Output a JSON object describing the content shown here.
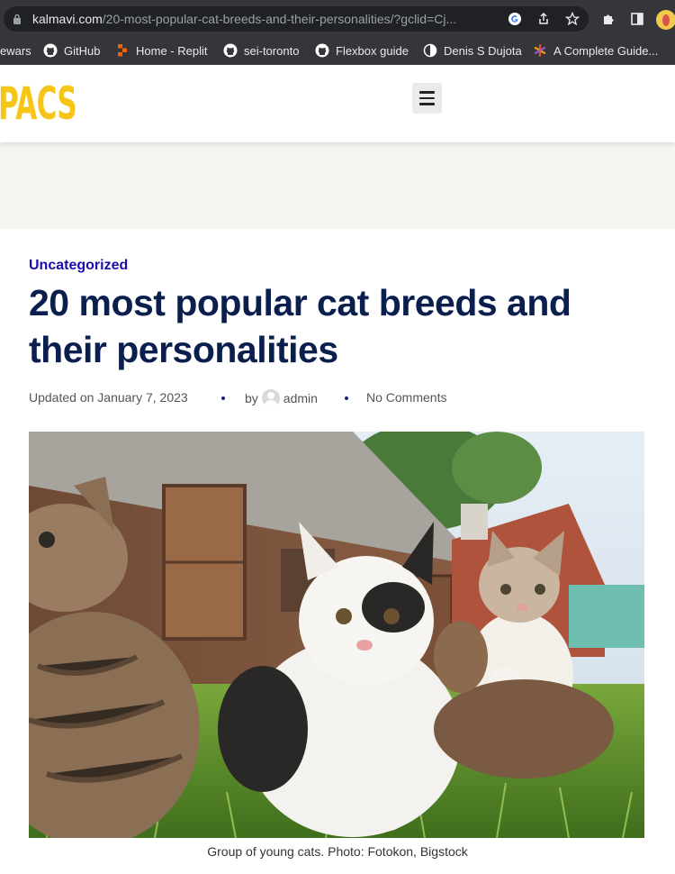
{
  "browser": {
    "url_host": "kalmavi.com",
    "url_path": "/20-most-popular-cat-breeds-and-their-personalities/?gclid=Cj...",
    "bookmarks": [
      {
        "label": "ewars",
        "icon": "none"
      },
      {
        "label": "GitHub",
        "icon": "github-icon"
      },
      {
        "label": "Home - Replit",
        "icon": "replit-icon"
      },
      {
        "label": "sei-toronto",
        "icon": "github-icon"
      },
      {
        "label": "Flexbox guide",
        "icon": "github-icon"
      },
      {
        "label": "Denis S Dujota",
        "icon": "half-circle-icon"
      },
      {
        "label": "A Complete Guide...",
        "icon": "asterisk-icon"
      }
    ]
  },
  "site": {
    "logo_text": "PACS",
    "logo_color": "#f5c518",
    "banner_color": "#f6f5f1"
  },
  "article": {
    "category": "Uncategorized",
    "title": "20 most popular cat breeds and their personalities",
    "updated": "Updated on January 7, 2023",
    "by_label": "by",
    "author": "admin",
    "comments": "No Comments",
    "image_alt": "group of kittens on grass in front of a wooden barn",
    "caption": "Group of young cats. Photo: Fotokon, Bigstock"
  },
  "colors": {
    "title": "#0b1f4e",
    "category": "#1a0dab",
    "chrome_bg": "#35363a"
  }
}
